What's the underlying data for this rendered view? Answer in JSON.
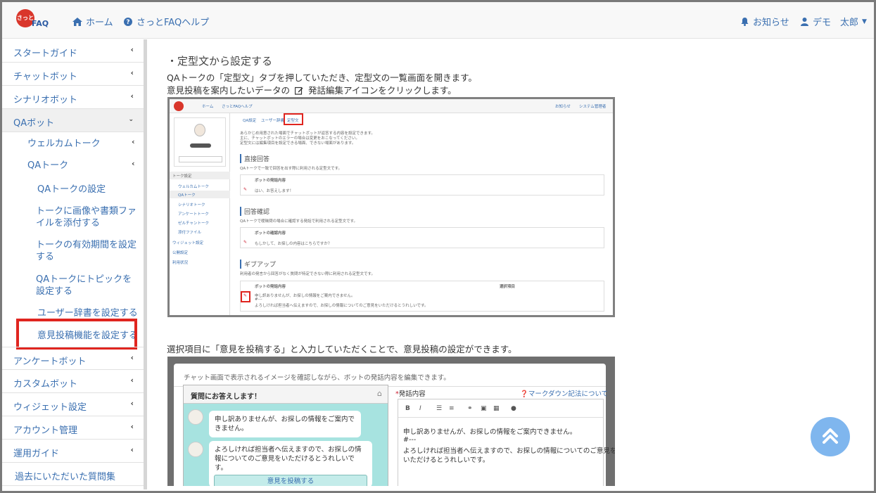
{
  "header": {
    "logo_text": "FAQ",
    "logo_mark": "さっと",
    "home": "ホーム",
    "help": "さっとFAQヘルプ",
    "notice": "お知らせ",
    "user": "デモ　太郎"
  },
  "sidebar": {
    "items": [
      {
        "label": "スタートガイド"
      },
      {
        "label": "チャットボット"
      },
      {
        "label": "シナリオボット"
      },
      {
        "label": "QAボット"
      },
      {
        "label": "ウェルカムトーク"
      },
      {
        "label": "QAトーク"
      },
      {
        "label": "QAトークの設定"
      },
      {
        "label": "トークに画像や書類ファイルを添付する"
      },
      {
        "label": "トークの有効期間を設定する"
      },
      {
        "label": "QAトークにトピックを設定する"
      },
      {
        "label": "ユーザー辞書を設定する"
      },
      {
        "label": "意見投稿機能を設定する"
      },
      {
        "label": "アンケートボット"
      },
      {
        "label": "カスタムボット"
      },
      {
        "label": "ウィジェット設定"
      },
      {
        "label": "アカウント管理"
      },
      {
        "label": "運用ガイド"
      },
      {
        "label": "過去にいただいた質問集"
      }
    ]
  },
  "main": {
    "section_title": "・定型文から設定する",
    "para1": "QAトークの「定型文」タブを押していただき、定型文の一覧画面を開きます。",
    "para2_before": "意見投稿を案内したいデータの",
    "para2_after": "発話編集アイコンをクリックします。",
    "para3": "選択項目に「意見を投稿する」と入力していただくことで、意見投稿の設定ができます。"
  },
  "shot1": {
    "tabs": [
      "QA設定",
      "ユーザー辞書",
      "定型文"
    ],
    "intro1": "あらかじめ用意された場面でチャットボットが返答する内容を設定できます。",
    "intro2": "主に、チャットボットのエラーの場合は変更をおこなってください。",
    "intro3": "定型文には編集項目を設定できる場面、できない場面があります。",
    "h1": "直接回答",
    "h1_desc": "QAトークで一致で回答を出す際に利用される定型文です。",
    "col": "ボットの発話内容",
    "row1": "はい、お答えします！",
    "h2": "回答確認",
    "h2_desc": "QAトークで曖昧問の場合に確認する発話で利用される定型文です。",
    "col2": "ボットの確認内容",
    "row2": "もしかして、お探しの内容はこちらですか？",
    "h3": "ギブアップ",
    "h3_desc": "利用者の発言から回答がなく質問が特定できない際に利用される定型文です。",
    "col3": "ボットの発話内容",
    "col3b": "選択項目",
    "row3a": "申し訳ありませんが、お探しの情報をご案内できません。",
    "row3b": "#---",
    "row3c": "よろしければ担当者へ伝えますので、お探しの情報についてのご意見をいただけるとうれしいです。",
    "side_items": [
      "トーク設定",
      "ウェルカムトーク",
      "QAトーク",
      "シナリオトーク",
      "アンケートトーク",
      "ゼルチャントーク",
      "添付ファイル",
      "ウィジェット設定",
      "公開設定",
      "利用状況"
    ],
    "bot_name": "さっさと",
    "header_home": "ホーム",
    "header_help": "さっとFAQヘルプ",
    "header_notice": "お知らせ",
    "header_user": "システム管理者"
  },
  "shot2": {
    "caption": "チャット画面で表示されるイメージを確認しながら、ボットの発話内容を編集できます。",
    "chat_title": "質問にお答えします！",
    "bubble1": "申し訳ありませんが、お探しの情報をご案内できません。",
    "bubble2": "よろしければ担当者へ伝えますので、お探しの情報についてのご意見をいただけるとうれしいです。",
    "button": "意見を投稿する",
    "label": "発話内容",
    "markdown_link": "マークダウン記法について",
    "editor_line1": "申し訳ありませんが、お探しの情報をご案内できません。",
    "editor_line2": "#---",
    "editor_line3": "よろしければ担当者へ伝えますので、お探しの情報についてのご意見を",
    "editor_line4": "いただけるとうれしいです。"
  },
  "colors": {
    "accent": "#3a6fb0",
    "highlight": "#e0251f",
    "chat_bg": "#a7e3e0",
    "scroll_top": "#7fb6ee"
  }
}
